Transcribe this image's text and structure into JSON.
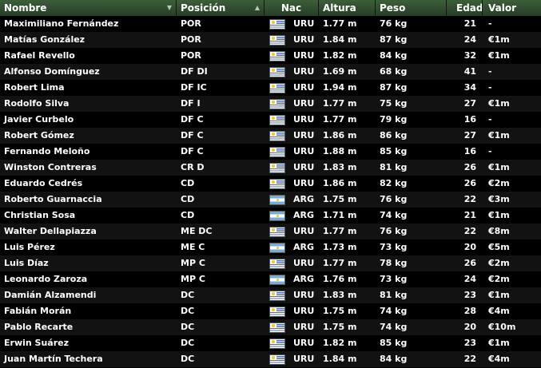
{
  "columns": [
    {
      "key": "nombre",
      "label": "Nombre",
      "indicator": "▼"
    },
    {
      "key": "posicion",
      "label": "Posición",
      "indicator": "▲"
    },
    {
      "key": "nac",
      "label": "Nac",
      "indicator": ""
    },
    {
      "key": "altura",
      "label": "Altura",
      "indicator": ""
    },
    {
      "key": "peso",
      "label": "Peso",
      "indicator": ""
    },
    {
      "key": "edad",
      "label": "Edad",
      "indicator": ""
    },
    {
      "key": "valor",
      "label": "Valor",
      "indicator": ""
    }
  ],
  "colors": {
    "header_bg": "#2f4a2e",
    "row_even": "#121212",
    "row_odd": "#000000",
    "text": "#ffffff"
  },
  "players": [
    {
      "nombre": "Maximiliano Fernández",
      "posicion": "POR",
      "flag": "uru-flag-icon",
      "nac": "URU",
      "altura": "1.77 m",
      "peso": "76 kg",
      "edad": "21",
      "valor": "-"
    },
    {
      "nombre": "Matías González",
      "posicion": "POR",
      "flag": "uru-flag-icon",
      "nac": "URU",
      "altura": "1.84 m",
      "peso": "87 kg",
      "edad": "24",
      "valor": "€1m"
    },
    {
      "nombre": "Rafael Revello",
      "posicion": "POR",
      "flag": "uru-flag-icon",
      "nac": "URU",
      "altura": "1.82 m",
      "peso": "84 kg",
      "edad": "32",
      "valor": "€1m"
    },
    {
      "nombre": "Alfonso Domínguez",
      "posicion": "DF DI",
      "flag": "uru-flag-icon",
      "nac": "URU",
      "altura": "1.69 m",
      "peso": "68 kg",
      "edad": "41",
      "valor": "-"
    },
    {
      "nombre": "Robert Lima",
      "posicion": "DF IC",
      "flag": "uru-flag-icon",
      "nac": "URU",
      "altura": "1.94 m",
      "peso": "87 kg",
      "edad": "34",
      "valor": "-"
    },
    {
      "nombre": "Rodolfo Silva",
      "posicion": "DF I",
      "flag": "uru-flag-icon",
      "nac": "URU",
      "altura": "1.77 m",
      "peso": "75 kg",
      "edad": "27",
      "valor": "€1m"
    },
    {
      "nombre": "Javier Curbelo",
      "posicion": "DF C",
      "flag": "uru-flag-icon",
      "nac": "URU",
      "altura": "1.77 m",
      "peso": "79 kg",
      "edad": "16",
      "valor": "-"
    },
    {
      "nombre": "Robert Gómez",
      "posicion": "DF C",
      "flag": "uru-flag-icon",
      "nac": "URU",
      "altura": "1.86 m",
      "peso": "86 kg",
      "edad": "27",
      "valor": "€1m"
    },
    {
      "nombre": "Fernando Meloño",
      "posicion": "DF C",
      "flag": "uru-flag-icon",
      "nac": "URU",
      "altura": "1.88 m",
      "peso": "85 kg",
      "edad": "16",
      "valor": "-"
    },
    {
      "nombre": "Winston Contreras",
      "posicion": "CR D",
      "flag": "uru-flag-icon",
      "nac": "URU",
      "altura": "1.83 m",
      "peso": "81 kg",
      "edad": "26",
      "valor": "€1m"
    },
    {
      "nombre": "Eduardo Cedrés",
      "posicion": "CD",
      "flag": "uru-flag-icon",
      "nac": "URU",
      "altura": "1.86 m",
      "peso": "82 kg",
      "edad": "26",
      "valor": "€2m"
    },
    {
      "nombre": "Roberto Guarnaccia",
      "posicion": "CD",
      "flag": "arg-flag-icon",
      "nac": "ARG",
      "altura": "1.75 m",
      "peso": "76 kg",
      "edad": "22",
      "valor": "€3m"
    },
    {
      "nombre": "Christian Sosa",
      "posicion": "CD",
      "flag": "arg-flag-icon",
      "nac": "ARG",
      "altura": "1.71 m",
      "peso": "74 kg",
      "edad": "21",
      "valor": "€1m"
    },
    {
      "nombre": "Walter Dellapiazza",
      "posicion": "ME DC",
      "flag": "uru-flag-icon",
      "nac": "URU",
      "altura": "1.77 m",
      "peso": "76 kg",
      "edad": "22",
      "valor": "€8m"
    },
    {
      "nombre": "Luis Pérez",
      "posicion": "ME C",
      "flag": "arg-flag-icon",
      "nac": "ARG",
      "altura": "1.73 m",
      "peso": "73 kg",
      "edad": "20",
      "valor": "€5m"
    },
    {
      "nombre": "Luis Díaz",
      "posicion": "MP C",
      "flag": "uru-flag-icon",
      "nac": "URU",
      "altura": "1.77 m",
      "peso": "78 kg",
      "edad": "26",
      "valor": "€2m"
    },
    {
      "nombre": "Leonardo Zaroza",
      "posicion": "MP C",
      "flag": "arg-flag-icon",
      "nac": "ARG",
      "altura": "1.76 m",
      "peso": "73 kg",
      "edad": "24",
      "valor": "€2m"
    },
    {
      "nombre": "Damián Alzamendi",
      "posicion": "DC",
      "flag": "uru-flag-icon",
      "nac": "URU",
      "altura": "1.83 m",
      "peso": "81 kg",
      "edad": "23",
      "valor": "€1m"
    },
    {
      "nombre": "Fabián Morán",
      "posicion": "DC",
      "flag": "uru-flag-icon",
      "nac": "URU",
      "altura": "1.75 m",
      "peso": "74 kg",
      "edad": "28",
      "valor": "€4m"
    },
    {
      "nombre": "Pablo Recarte",
      "posicion": "DC",
      "flag": "uru-flag-icon",
      "nac": "URU",
      "altura": "1.75 m",
      "peso": "74 kg",
      "edad": "20",
      "valor": "€10m"
    },
    {
      "nombre": "Erwin Suárez",
      "posicion": "DC",
      "flag": "uru-flag-icon",
      "nac": "URU",
      "altura": "1.82 m",
      "peso": "85 kg",
      "edad": "23",
      "valor": "€1m"
    },
    {
      "nombre": "Juan Martín Techera",
      "posicion": "DC",
      "flag": "uru-flag-icon",
      "nac": "URU",
      "altura": "1.84 m",
      "peso": "84 kg",
      "edad": "22",
      "valor": "€4m"
    }
  ]
}
